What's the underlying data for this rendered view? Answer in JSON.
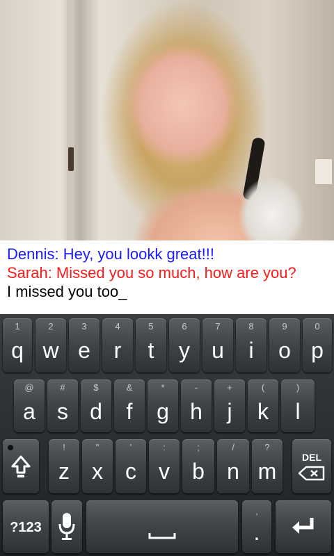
{
  "chat": {
    "messages": [
      {
        "text": "Dennis: Hey, you lookk great!!!",
        "color": "#1a1aff"
      },
      {
        "text": "Sarah: Missed you so much, how are you?",
        "color": "#ff1a1a"
      }
    ],
    "input_text": "I missed you too_"
  },
  "keyboard": {
    "row1": [
      {
        "alt": "1",
        "main": "q"
      },
      {
        "alt": "2",
        "main": "w"
      },
      {
        "alt": "3",
        "main": "e"
      },
      {
        "alt": "4",
        "main": "r"
      },
      {
        "alt": "5",
        "main": "t"
      },
      {
        "alt": "6",
        "main": "y"
      },
      {
        "alt": "7",
        "main": "u"
      },
      {
        "alt": "8",
        "main": "i"
      },
      {
        "alt": "9",
        "main": "o"
      },
      {
        "alt": "0",
        "main": "p"
      }
    ],
    "row2": [
      {
        "alt": "@",
        "main": "a"
      },
      {
        "alt": "#",
        "main": "s"
      },
      {
        "alt": "$",
        "main": "d"
      },
      {
        "alt": "&",
        "main": "f"
      },
      {
        "alt": "*",
        "main": "g"
      },
      {
        "alt": "-",
        "main": "h"
      },
      {
        "alt": "+",
        "main": "j"
      },
      {
        "alt": "(",
        "main": "k"
      },
      {
        "alt": ")",
        "main": "l"
      }
    ],
    "row3": [
      {
        "alt": "!",
        "main": "z"
      },
      {
        "alt": "\"",
        "main": "x"
      },
      {
        "alt": "'",
        "main": "c"
      },
      {
        "alt": ":",
        "main": "v"
      },
      {
        "alt": ";",
        "main": "b"
      },
      {
        "alt": "/",
        "main": "n"
      },
      {
        "alt": "?",
        "main": "m"
      }
    ],
    "del_label": "DEL",
    "sym_label": "?123",
    "period_alt": ",",
    "period_main": ".",
    "icons": {
      "shift": "shift-icon",
      "delete": "backspace-icon",
      "mic": "microphone-icon",
      "space": "space-bar-icon",
      "enter": "enter-arrow-icon"
    }
  }
}
